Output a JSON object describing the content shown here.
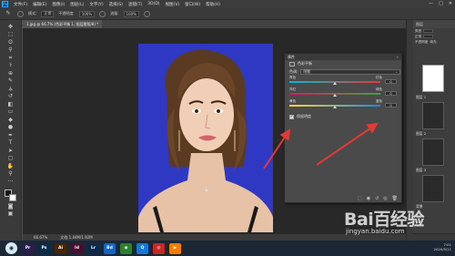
{
  "app": {
    "logo": "Ps",
    "menu": [
      "文件(F)",
      "编辑(E)",
      "图像(I)",
      "图层(L)",
      "文字(Y)",
      "选择(S)",
      "滤镜(T)",
      "3D(D)",
      "视图(V)",
      "窗口(W)",
      "帮助(H)"
    ],
    "window_controls": [
      "—",
      "□",
      "✕"
    ]
  },
  "options_bar": {
    "mode_label": "模式:",
    "mode_value": "正常",
    "opacity_label": "不透明度:",
    "opacity_value": "100%",
    "flow_label": "流量:",
    "flow_value": "100%"
  },
  "document": {
    "tab_title": "1.jpg @ 66.7% (色彩平衡 1, 图层蒙版/8) *",
    "zoom": "66.67%",
    "doc_info": "文档:1.44M/1.92M"
  },
  "properties_panel": {
    "title": "属性",
    "subtitle": "色彩平衡",
    "tone_label": "色调:",
    "tone_value": "阴影",
    "sliders": [
      {
        "left": "青色",
        "right": "红色",
        "value": "0",
        "position": 0.5,
        "colors": [
          "#00bcd4",
          "#e53935"
        ]
      },
      {
        "left": "洋红",
        "right": "绿色",
        "value": "0",
        "position": 0.5,
        "colors": [
          "#d81b60",
          "#43a047"
        ]
      },
      {
        "left": "黄色",
        "right": "蓝色",
        "value": "0",
        "position": 0.5,
        "colors": [
          "#fdd835",
          "#1e88e5"
        ]
      }
    ],
    "preserve_luminosity": "保留明度"
  },
  "layers_panel": {
    "header": "图层",
    "kind_label": "类型",
    "blend_label": "正常",
    "opacity_label": "不透明度",
    "fill_label": "填充",
    "layers": [
      "图层 1",
      "图层 2",
      "图层 3",
      "背景"
    ]
  },
  "taskbar": {
    "apps": [
      {
        "label": "Pr",
        "color": "#2a1e4d"
      },
      {
        "label": "Ps",
        "color": "#0b2a4a"
      },
      {
        "label": "Ai",
        "color": "#4a2300"
      },
      {
        "label": "Id",
        "color": "#4a0e2e"
      },
      {
        "label": "Lr",
        "color": "#0b2a4a"
      },
      {
        "label": "Bd",
        "color": "#1565c0"
      },
      {
        "label": "◉",
        "color": "#2e7d32"
      },
      {
        "label": "Q",
        "color": "#1976d2"
      },
      {
        "label": "◎",
        "color": "#c62828"
      },
      {
        "label": "▶",
        "color": "#f57c00"
      }
    ],
    "clock_time": "7:01",
    "clock_date": "2020/5/11"
  },
  "watermark": {
    "brand": "Bai百经验",
    "url": "jingyan.baidu.com"
  },
  "colors": {
    "canvas_bg": "#282828",
    "photo_bg": "#2f38c2",
    "arrow": "#e53935"
  }
}
